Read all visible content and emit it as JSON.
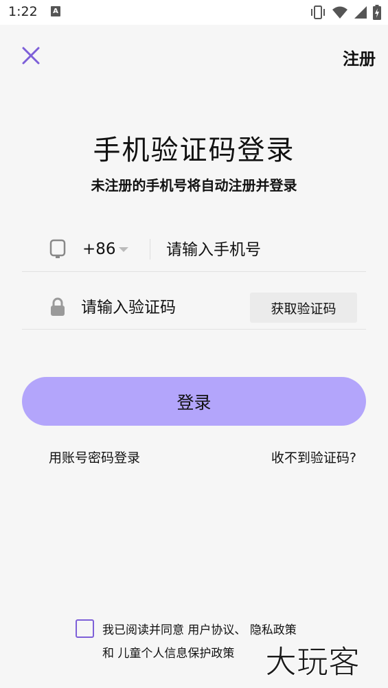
{
  "status_bar": {
    "time": "1:22",
    "notification_badge": "A",
    "icons": [
      "vibrate-icon",
      "wifi-icon",
      "signal-icon",
      "battery-icon"
    ]
  },
  "nav": {
    "register_label": "注册"
  },
  "title": "手机验证码登录",
  "subtitle": "未注册的手机号将自动注册并登录",
  "phone": {
    "country_code": "+86",
    "placeholder": "请输入手机号"
  },
  "code": {
    "placeholder": "请输入验证码",
    "get_code_label": "获取验证码"
  },
  "login_label": "登录",
  "alt_login_label": "用账号密码登录",
  "no_code_label": "收不到验证码?",
  "agreement": {
    "prefix": "我已阅读并同意",
    "user_agreement": "用户协议",
    "separator": "、",
    "privacy_policy": "隐私政策",
    "and": "和",
    "child_policy": "儿童个人信息保护政策"
  },
  "watermark": "大玩客",
  "colors": {
    "accent": "#7d5fd8",
    "login_button": "#b3a5fb",
    "background": "#f6f6f6"
  }
}
